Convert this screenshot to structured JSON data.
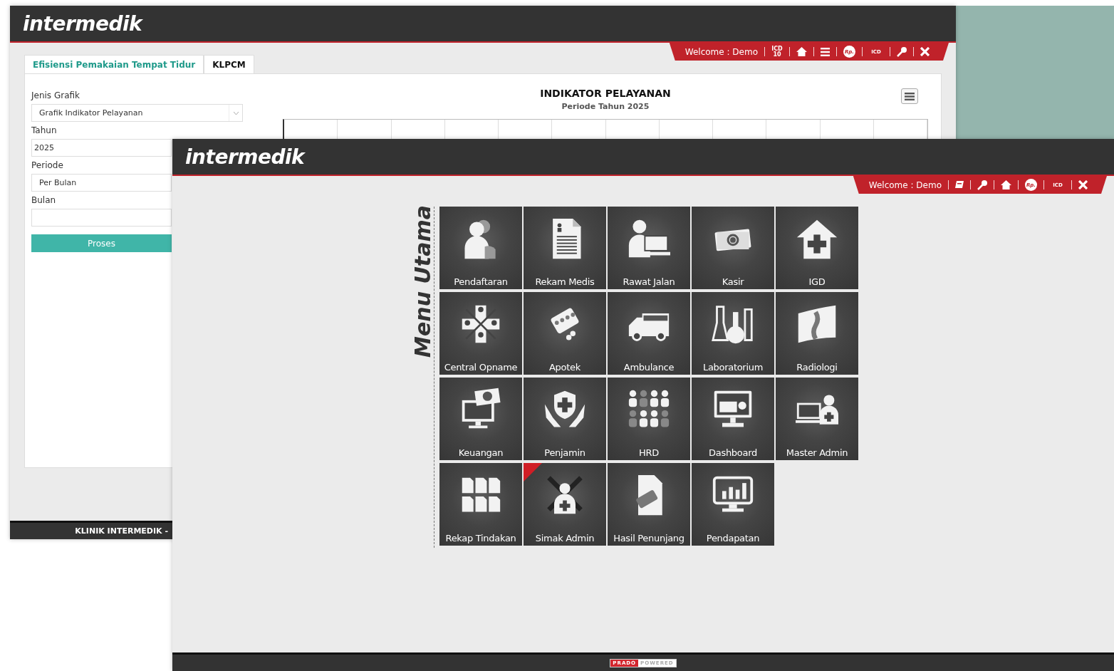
{
  "back_window": {
    "logo": "intermedik",
    "toolbar": [
      {
        "kind": "text",
        "label": "Welcome : Demo"
      },
      {
        "kind": "code",
        "label": "ICD 10"
      },
      {
        "kind": "home"
      },
      {
        "kind": "menu"
      },
      {
        "kind": "coin",
        "label": "Rp."
      },
      {
        "kind": "code",
        "label": "ICD"
      },
      {
        "kind": "key"
      },
      {
        "kind": "close"
      }
    ],
    "tabs": [
      {
        "label": "Efisiensi Pemakaian Tempat Tidur",
        "selected": true
      },
      {
        "label": "KLPCM",
        "selected": false
      }
    ],
    "form": [
      {
        "label": "Jenis Grafik",
        "kind": "select",
        "value": "Grafik Indikator Pelayanan"
      },
      {
        "label": "Tahun",
        "kind": "input",
        "value": "2025"
      },
      {
        "label": "Periode",
        "kind": "select",
        "value": "Per Bulan"
      },
      {
        "label": "Bulan",
        "kind": "input"
      }
    ],
    "button": "Proses",
    "chart": {
      "title": "INDIKATOR PELAYANAN",
      "subtitle": "Periode Tahun 2025"
    },
    "footer": "KLINIK INTERMEDIK -"
  },
  "front_window": {
    "logo": "intermedik",
    "toolbar": [
      {
        "kind": "text",
        "label": "Welcome : Demo"
      },
      {
        "kind": "book"
      },
      {
        "kind": "key"
      },
      {
        "kind": "home"
      },
      {
        "kind": "coin",
        "label": "Rp."
      },
      {
        "kind": "code",
        "label": "ICD"
      },
      {
        "kind": "close"
      }
    ],
    "menu_title": "Menu Utama",
    "tiles": [
      {
        "label": "Pendaftaran",
        "flagged": false
      },
      {
        "label": "Rekam Medis",
        "flagged": false
      },
      {
        "label": "Rawat Jalan",
        "flagged": false
      },
      {
        "label": "Kasir",
        "flagged": false
      },
      {
        "label": "IGD",
        "flagged": false
      },
      {
        "label": "Central Opname",
        "flagged": false
      },
      {
        "label": "Apotek",
        "flagged": false
      },
      {
        "label": "Ambulance",
        "flagged": false
      },
      {
        "label": "Laboratorium",
        "flagged": false
      },
      {
        "label": "Radiologi",
        "flagged": false
      },
      {
        "label": "Keuangan",
        "flagged": false
      },
      {
        "label": "Penjamin",
        "flagged": false
      },
      {
        "label": "HRD",
        "flagged": false
      },
      {
        "label": "Dashboard",
        "flagged": false
      },
      {
        "label": "Master Admin",
        "flagged": false
      },
      {
        "label": "Rekap Tindakan",
        "flagged": false
      },
      {
        "label": "Simak Admin",
        "flagged": true
      },
      {
        "label": "Hasil Penunjang",
        "flagged": false
      },
      {
        "label": "Pendapatan",
        "flagged": false
      }
    ],
    "footer_badge": {
      "brand": "PRADO",
      "text": "POWERED"
    }
  }
}
